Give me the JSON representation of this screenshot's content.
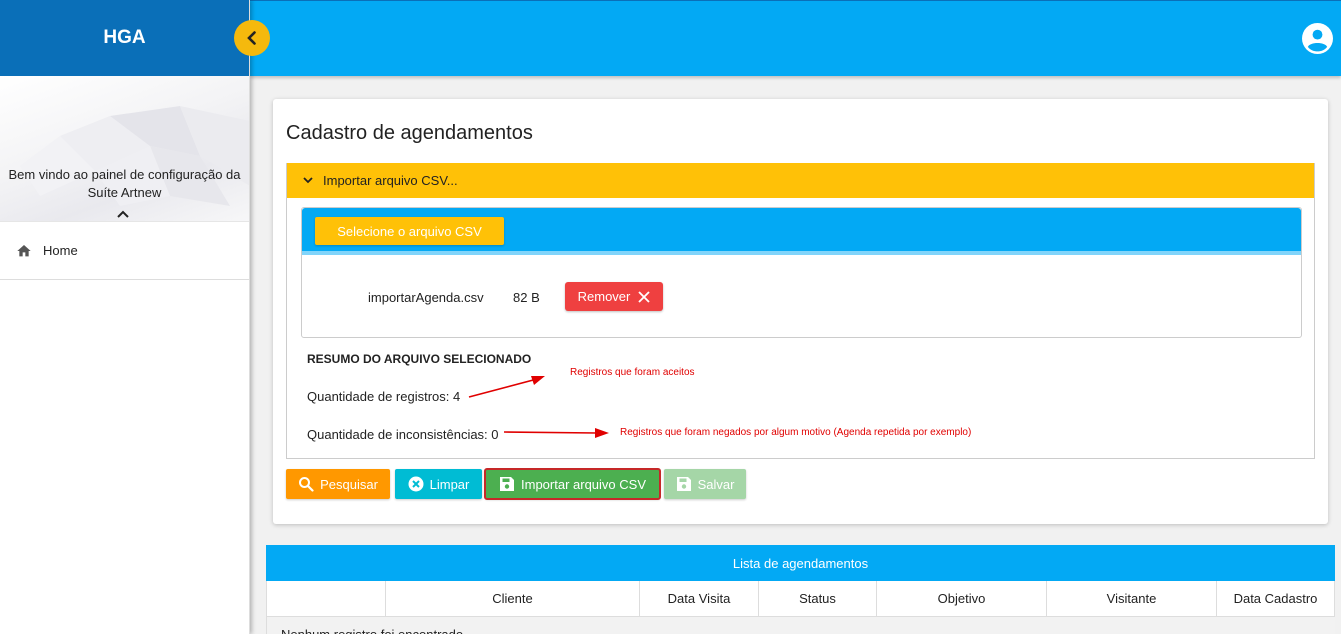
{
  "sidebar": {
    "title": "HGA",
    "welcome": "Bem vindo ao painel de configuração da Suíte Artnew",
    "nav": [
      {
        "label": "Home",
        "icon": "home-icon"
      }
    ]
  },
  "topbar": {
    "account_icon": "account-circle-icon"
  },
  "page": {
    "title": "Cadastro de agendamentos"
  },
  "accordion": {
    "label": "Importar arquivo CSV..."
  },
  "upload": {
    "select_label": "Selecione o arquivo CSV",
    "file_name": "importarAgenda.csv",
    "file_size": "82 B",
    "remove_label": "Remover"
  },
  "summary": {
    "title": "RESUMO DO ARQUIVO SELECIONADO",
    "records": "Quantidade de registros: 4",
    "inconsistencies": "Quantidade de inconsistências: 0"
  },
  "annotations": {
    "accepted": "Registros que foram aceitos",
    "denied": "Registros que foram negados por algum motivo (Agenda repetida por exemplo)"
  },
  "buttons": {
    "search": "Pesquisar",
    "clear": "Limpar",
    "import": "Importar arquivo CSV",
    "save": "Salvar"
  },
  "table": {
    "title": "Lista de agendamentos",
    "columns": [
      "",
      "Cliente",
      "Data Visita",
      "Status",
      "Objetivo",
      "Visitante",
      "Data Cadastro"
    ],
    "empty_message": "Nenhum registro foi encontrado"
  },
  "colors": {
    "primary": "#03a9f4",
    "sidebar_header": "#0a6fb8",
    "accent": "#ffc107",
    "danger": "#ef4040",
    "success": "#4caf50",
    "annotation": "#e00000"
  }
}
